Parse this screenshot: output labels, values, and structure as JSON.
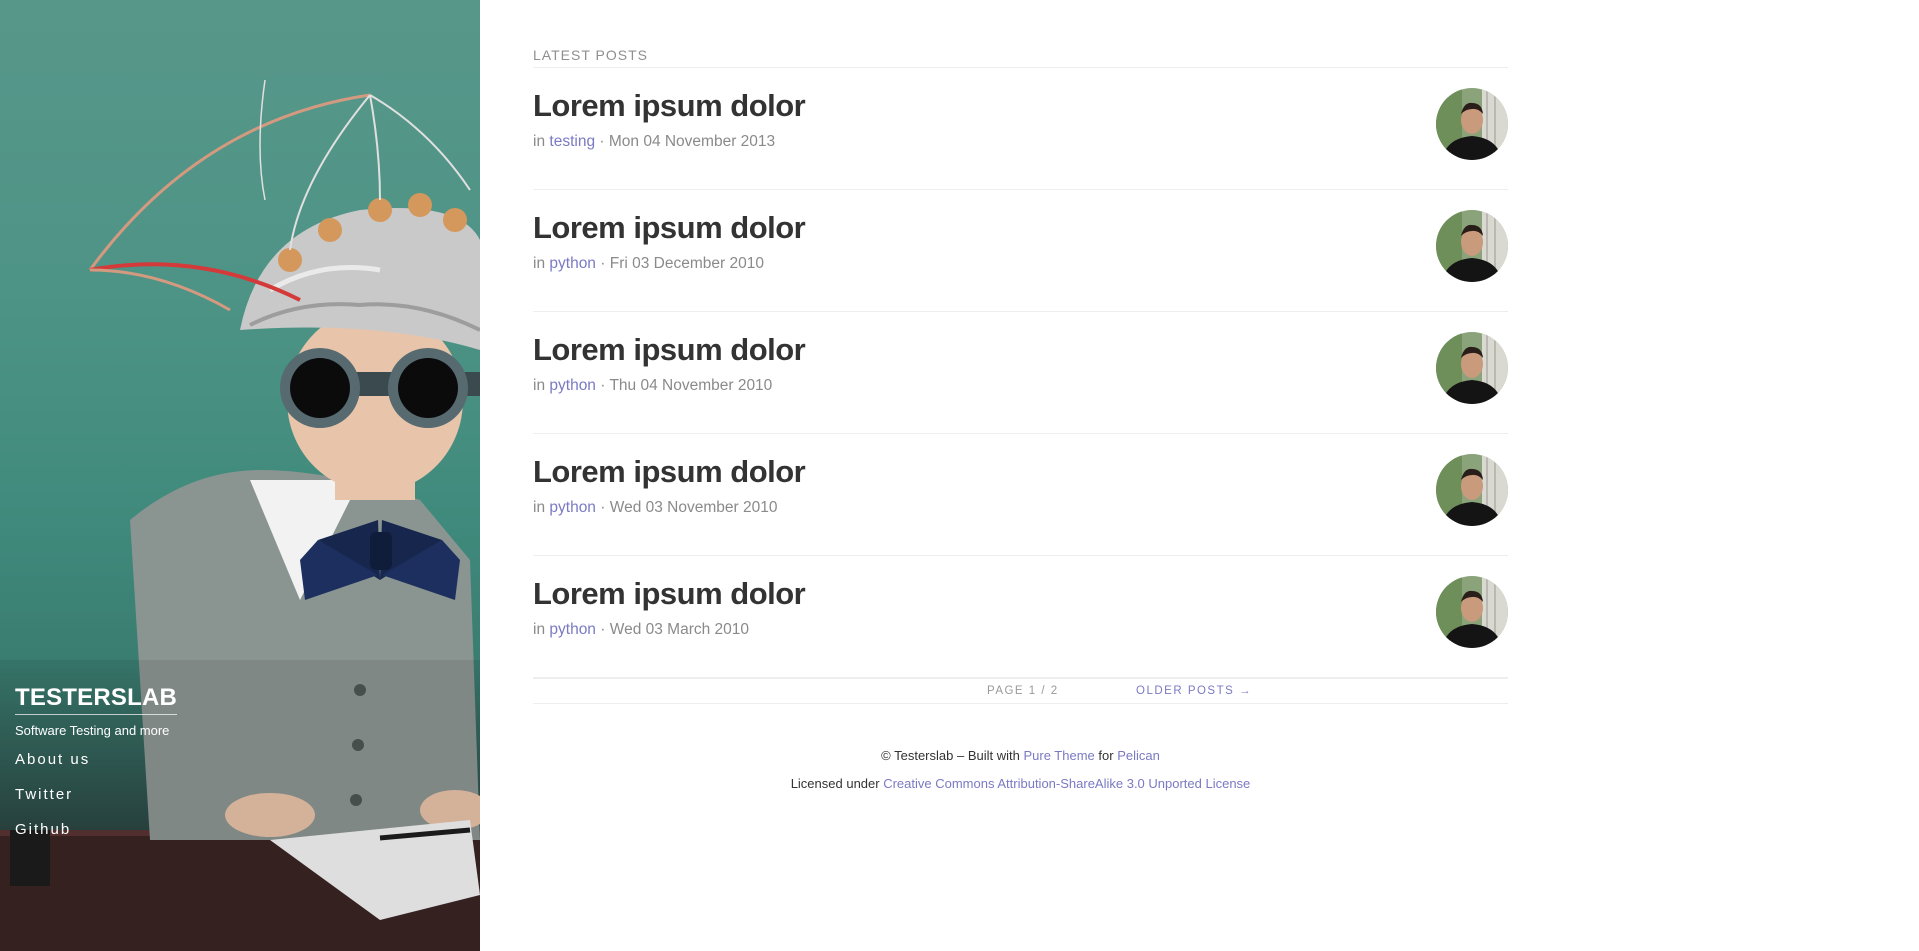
{
  "sidebar": {
    "title": "TESTERSLAB",
    "tagline": "Software Testing and more",
    "nav": [
      {
        "label": "About us"
      },
      {
        "label": "Twitter"
      },
      {
        "label": "Github"
      }
    ]
  },
  "main": {
    "heading": "LATEST POSTS",
    "posts": [
      {
        "title": "Lorem ipsum dolor",
        "prefix": "in",
        "category": "testing",
        "separator": "·",
        "date": "Mon 04 November 2013"
      },
      {
        "title": "Lorem ipsum dolor",
        "prefix": "in",
        "category": "python",
        "separator": "·",
        "date": "Fri 03 December 2010"
      },
      {
        "title": "Lorem ipsum dolor",
        "prefix": "in",
        "category": "python",
        "separator": "·",
        "date": "Thu 04 November 2010"
      },
      {
        "title": "Lorem ipsum dolor",
        "prefix": "in",
        "category": "python",
        "separator": "·",
        "date": "Wed 03 November 2010"
      },
      {
        "title": "Lorem ipsum dolor",
        "prefix": "in",
        "category": "python",
        "separator": "·",
        "date": "Wed 03 March 2010"
      }
    ],
    "pagination": {
      "page_info": "PAGE 1 / 2",
      "older_label": "OLDER POSTS →"
    }
  },
  "footer": {
    "line1_prefix": "© Testerslab – Built with",
    "pure_theme": "Pure Theme",
    "for_text": "for",
    "pelican": "Pelican",
    "line2_prefix": "Licensed under",
    "license": "Creative Commons Attribution-ShareAlike 3.0 Unported License"
  },
  "colors": {
    "link": "#7a7ac4",
    "title": "#333333",
    "meta": "#8a8a8a",
    "sidebar_bg": "#4e9486"
  },
  "icons": {
    "avatar": "author-avatar",
    "arrow": "right-arrow"
  }
}
